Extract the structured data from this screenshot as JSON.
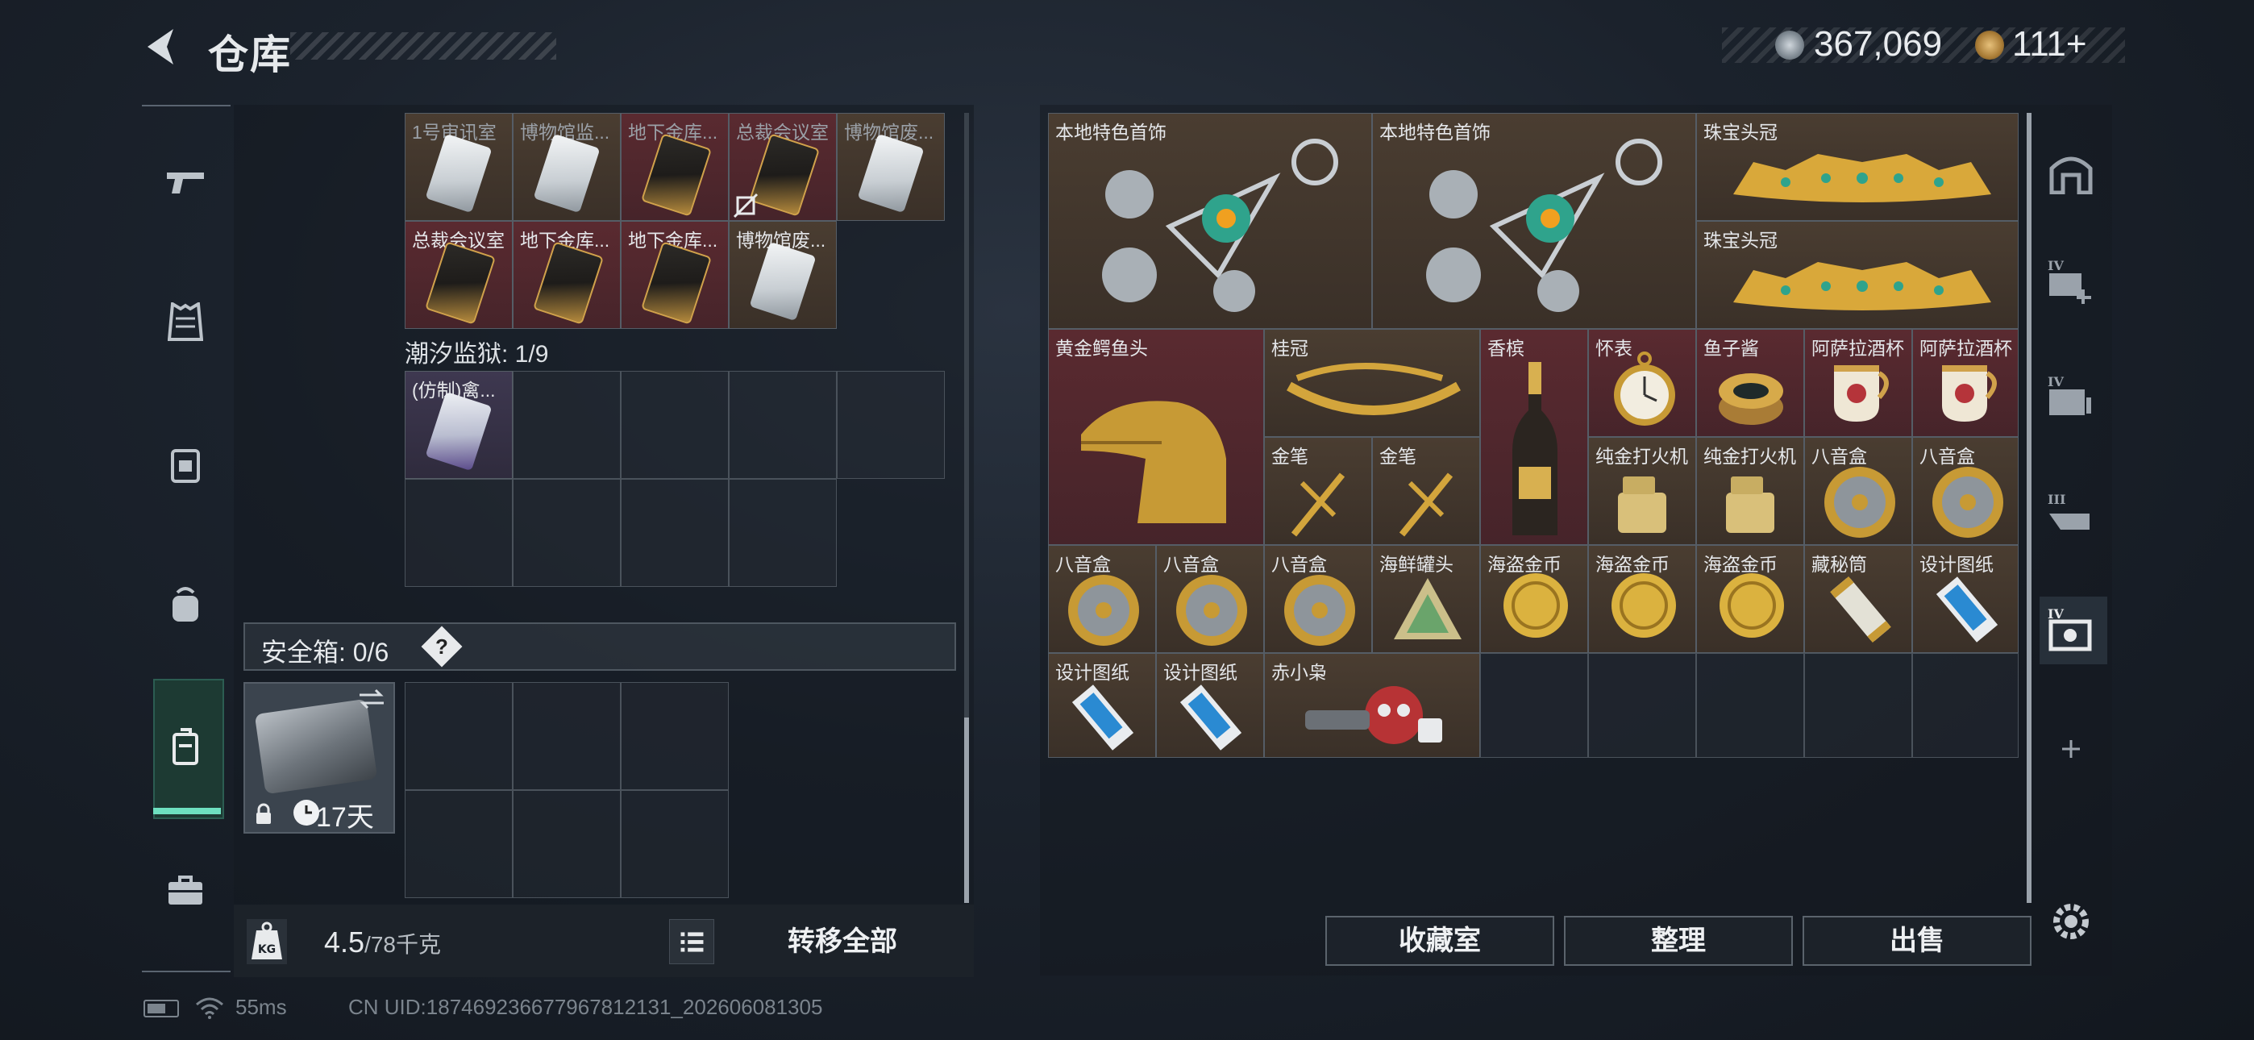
{
  "header": {
    "title": "仓库",
    "money": "367,069",
    "tokens": "111+"
  },
  "left": {
    "tide_label": "潮汐监狱: 1/9",
    "top_items": [
      {
        "label": "1号审讯室",
        "color": "brown",
        "card": "white",
        "dim": true
      },
      {
        "label": "博物馆监...",
        "color": "brown",
        "card": "white",
        "dim": true
      },
      {
        "label": "地下金库...",
        "color": "red",
        "card": "gold",
        "dim": true
      },
      {
        "label": "总裁会议室",
        "color": "red",
        "card": "gold",
        "dim": true
      },
      {
        "label": "博物馆废...",
        "color": "brown",
        "card": "white",
        "dim": true
      },
      {
        "label": "总裁会议室",
        "color": "red",
        "card": "gold",
        "dim": false
      },
      {
        "label": "地下金库...",
        "color": "red",
        "card": "gold",
        "dim": false
      },
      {
        "label": "地下金库...",
        "color": "red",
        "card": "gold",
        "dim": false
      },
      {
        "label": "博物馆废...",
        "color": "brown",
        "card": "white",
        "dim": false
      }
    ],
    "tide_item": {
      "label": "(仿制)禽..."
    },
    "safe_label": "安全箱: 0/6",
    "safe_help": "?",
    "case_days": "17天",
    "weight_value": "4.5",
    "weight_total": "/78千克",
    "transfer_all": "转移全部"
  },
  "right": {
    "items": [
      {
        "label": "本地特色首饰",
        "color": "brown",
        "icon": "necklace-icon"
      },
      {
        "label": "本地特色首饰",
        "color": "brown",
        "icon": "necklace-icon"
      },
      {
        "label": "珠宝头冠",
        "color": "brown",
        "icon": "tiara-icon"
      },
      {
        "label": "珠宝头冠",
        "color": "brown",
        "icon": "tiara-icon"
      },
      {
        "label": "黄金鳄鱼头",
        "color": "red",
        "icon": "golden-crocodile-head-icon"
      },
      {
        "label": "桂冠",
        "color": "brown",
        "icon": "laurel-crown-icon"
      },
      {
        "label": "香槟",
        "color": "red",
        "icon": "champagne-bottle-icon"
      },
      {
        "label": "怀表",
        "color": "red",
        "icon": "pocket-watch-icon"
      },
      {
        "label": "鱼子酱",
        "color": "red",
        "icon": "caviar-tin-icon"
      },
      {
        "label": "阿萨拉酒杯",
        "color": "red",
        "icon": "goblet-icon"
      },
      {
        "label": "阿萨拉酒杯",
        "color": "red",
        "icon": "goblet-icon"
      },
      {
        "label": "金笔",
        "color": "brown",
        "icon": "gold-pen-icon"
      },
      {
        "label": "金笔",
        "color": "brown",
        "icon": "gold-pen-icon"
      },
      {
        "label": "纯金打火机",
        "color": "brown",
        "icon": "lighter-icon"
      },
      {
        "label": "纯金打火机",
        "color": "brown",
        "icon": "lighter-icon"
      },
      {
        "label": "八音盒",
        "color": "brown",
        "icon": "music-box-icon"
      },
      {
        "label": "八音盒",
        "color": "brown",
        "icon": "music-box-icon"
      },
      {
        "label": "八音盒",
        "color": "brown",
        "icon": "music-box-icon"
      },
      {
        "label": "八音盒",
        "color": "brown",
        "icon": "music-box-icon"
      },
      {
        "label": "八音盒",
        "color": "brown",
        "icon": "music-box-icon"
      },
      {
        "label": "海鲜罐头",
        "color": "brown",
        "icon": "seafood-can-icon"
      },
      {
        "label": "海盗金币",
        "color": "brown",
        "icon": "pirate-coin-icon"
      },
      {
        "label": "海盗金币",
        "color": "brown",
        "icon": "pirate-coin-icon"
      },
      {
        "label": "海盗金币",
        "color": "brown",
        "icon": "pirate-coin-icon"
      },
      {
        "label": "藏秘筒",
        "color": "brown",
        "icon": "cryptex-icon"
      },
      {
        "label": "设计图纸",
        "color": "brown",
        "icon": "blueprint-icon"
      },
      {
        "label": "设计图纸",
        "color": "brown",
        "icon": "blueprint-icon"
      },
      {
        "label": "设计图纸",
        "color": "brown",
        "icon": "blueprint-icon"
      },
      {
        "label": "赤小枭",
        "color": "brown",
        "icon": "red-owl-figure-icon"
      }
    ],
    "buttons": {
      "collection": "收藏室",
      "organize": "整理",
      "sell": "出售"
    }
  },
  "status": {
    "ping": "55ms",
    "uid": "CN UID:18746923667796781213​1_202606081305"
  },
  "colors": {
    "brown": "#4a3d31",
    "red": "#5a2a30",
    "accent": "#6ee0c0"
  }
}
